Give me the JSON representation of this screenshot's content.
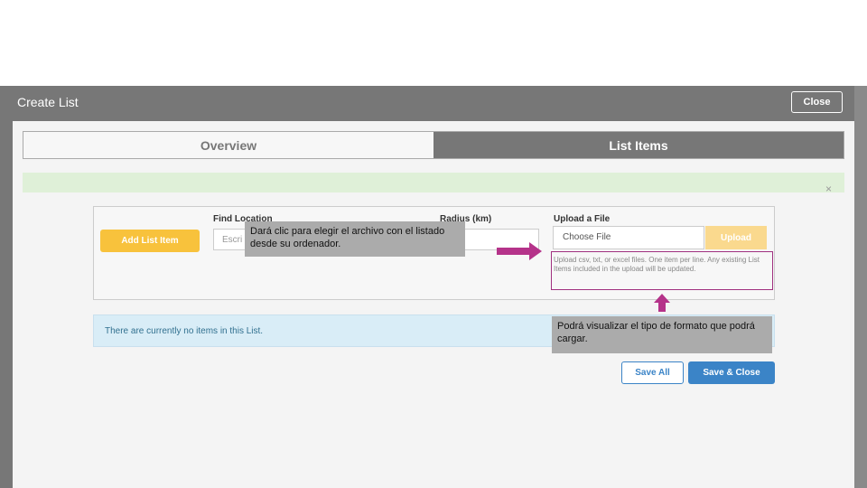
{
  "modal": {
    "title": "Create List",
    "close_label": "Close"
  },
  "tabs": [
    {
      "label": "Overview",
      "active": false
    },
    {
      "label": "List Items",
      "active": true
    }
  ],
  "alert": {
    "close_glyph": "×"
  },
  "form": {
    "add_button_label": "Add List Item",
    "find_location_label": "Find Location",
    "find_location_placeholder": "Escri",
    "radius_label": "Radius (km)",
    "upload_label": "Upload a File",
    "choose_file_label": "Choose File",
    "upload_button_label": "Upload",
    "help_text": "Upload csv, txt, or excel files. One item per line. Any existing List Items included in the upload will be updated."
  },
  "info": {
    "empty_message": "There are currently no items in this List."
  },
  "footer": {
    "save_all_label": "Save All",
    "save_close_label": "Save & Close"
  },
  "annotations": {
    "callout_choose_file": "Dará clic para elegir el archivo con el listado desde su ordenador.",
    "callout_format": "Podrá visualizar el tipo de formato que podrá cargar."
  },
  "colors": {
    "accent_yellow": "#f8c23c",
    "primary_blue": "#3b84c7",
    "annotation_arrow": "#b5338a",
    "header_gray": "#777777"
  }
}
